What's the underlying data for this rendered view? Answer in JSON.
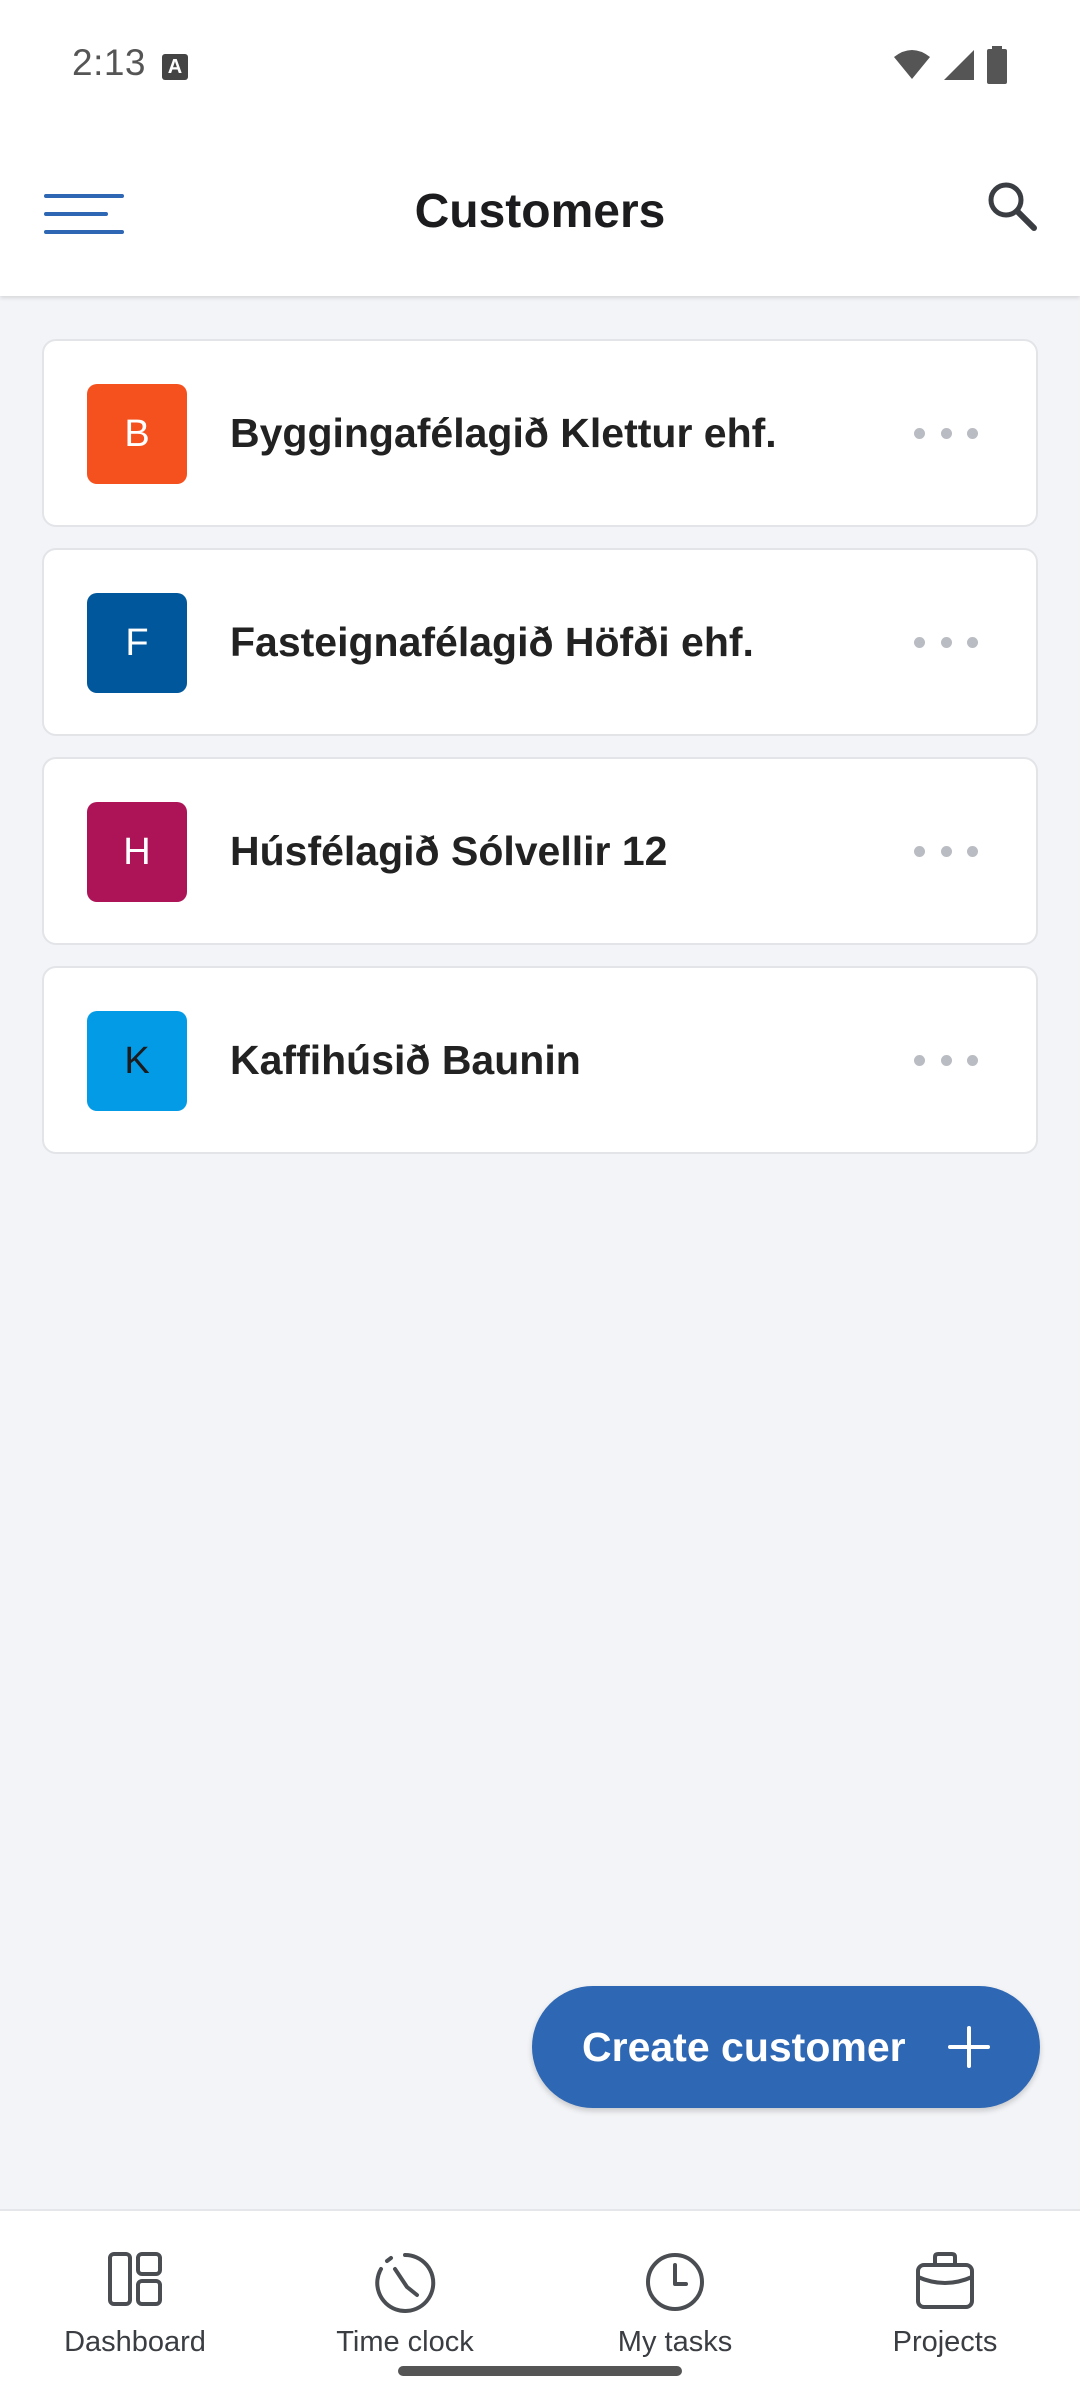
{
  "status_bar": {
    "time": "2:13",
    "a_badge": "A",
    "icons": [
      "wifi-icon",
      "cell-signal-icon",
      "battery-icon"
    ]
  },
  "header": {
    "title": "Customers",
    "menu_icon": "hamburger-menu-icon",
    "search_icon": "search-icon"
  },
  "customers": [
    {
      "initial": "B",
      "name": "Byggingafélagið Klettur ehf.",
      "color": "#f4511e"
    },
    {
      "initial": "F",
      "name": "Fasteignafélagið Höfði ehf.",
      "color": "#01579b"
    },
    {
      "initial": "H",
      "name": "Húsfélagið Sólvellir 12",
      "color": "#ad1457"
    },
    {
      "initial": "K",
      "name": "Kaffihúsið Baunin",
      "color": "#039be5"
    }
  ],
  "fab": {
    "label": "Create customer",
    "icon": "plus-icon"
  },
  "bottom_nav": [
    {
      "label": "Dashboard",
      "icon": "dashboard-icon"
    },
    {
      "label": "Time clock",
      "icon": "time-clock-icon"
    },
    {
      "label": "My tasks",
      "icon": "clock-icon"
    },
    {
      "label": "Projects",
      "icon": "briefcase-icon"
    }
  ],
  "colors": {
    "accent": "#2e67b3",
    "background": "#f3f4f7"
  }
}
